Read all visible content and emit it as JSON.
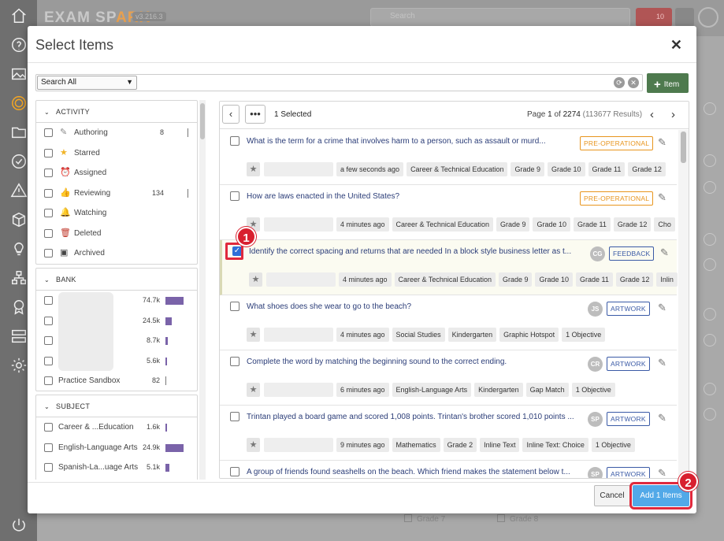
{
  "app": {
    "logo_part1": "EXAM SP",
    "logo_part2": "ARK",
    "version": "v3.216.3",
    "search_placeholder": "Search",
    "notification_count": "10"
  },
  "modal": {
    "title": "Select Items",
    "close_label": "✕",
    "search_select_value": "Search All",
    "add_item_label": "Item",
    "cancel_label": "Cancel",
    "confirm_label": "Add 1 Items"
  },
  "activity": {
    "header": "ACTIVITY",
    "items": [
      {
        "label": "Authoring",
        "count": "8",
        "icon": "pencil-icon"
      },
      {
        "label": "Starred",
        "count": "",
        "icon": "star-icon"
      },
      {
        "label": "Assigned",
        "count": "",
        "icon": "alarm-clock-icon"
      },
      {
        "label": "Reviewing",
        "count": "134",
        "icon": "thumbs-up-icon"
      },
      {
        "label": "Watching",
        "count": "",
        "icon": "bell-icon"
      },
      {
        "label": "Deleted",
        "count": "",
        "icon": "trash-icon"
      },
      {
        "label": "Archived",
        "count": "",
        "icon": "archive-icon"
      }
    ]
  },
  "bank": {
    "header": "BANK",
    "items": [
      {
        "label": "",
        "count": "74.7k",
        "fill": 1.0
      },
      {
        "label": "",
        "count": "24.5k",
        "fill": 0.33
      },
      {
        "label": "",
        "count": "8.7k",
        "fill": 0.12
      },
      {
        "label": "",
        "count": "5.6k",
        "fill": 0.08
      },
      {
        "label": "Practice Sandbox",
        "count": "82",
        "fill": 0.0
      }
    ]
  },
  "subject": {
    "header": "SUBJECT",
    "items": [
      {
        "label": "Career & ...Education",
        "count": "1.6k",
        "fill": 0.07
      },
      {
        "label": "English-Language Arts",
        "count": "24.9k",
        "fill": 1.0
      },
      {
        "label": "Spanish-La...uage Arts",
        "count": "5.1k",
        "fill": 0.2
      }
    ]
  },
  "results": {
    "selected_text": "1 Selected",
    "page_prefix": "Page ",
    "page_current": "1",
    "page_of": " of ",
    "page_total": "2274",
    "results_count": " (113677 Results)",
    "items": [
      {
        "question": "What is the term for a crime that involves harm to a person, such as assault or murd...",
        "status": "PRE-OPERATIONAL",
        "avatar": "",
        "checked": false,
        "time": "a few seconds ago",
        "tags": [
          "Career & Technical Education",
          "Grade 9",
          "Grade 10",
          "Grade 11",
          "Grade 12"
        ]
      },
      {
        "question": "How are laws enacted in the United States?",
        "status": "PRE-OPERATIONAL",
        "avatar": "",
        "checked": false,
        "time": "4 minutes ago",
        "tags": [
          "Career & Technical Education",
          "Grade 9",
          "Grade 10",
          "Grade 11",
          "Grade 12",
          "Cho"
        ]
      },
      {
        "question": "Identify the correct spacing and returns that are needed In a block style business letter as t...",
        "status": "FEEDBACK",
        "avatar": "CG",
        "checked": true,
        "time": "4 minutes ago",
        "tags": [
          "Career & Technical Education",
          "Grade 9",
          "Grade 10",
          "Grade 11",
          "Grade 12",
          "Inlin"
        ]
      },
      {
        "question": "What shoes does she wear to go to the beach?",
        "status": "ARTWORK",
        "avatar": "JS",
        "checked": false,
        "time": "4 minutes ago",
        "tags": [
          "Social Studies",
          "Kindergarten",
          "Graphic Hotspot",
          "1 Objective"
        ]
      },
      {
        "question": "Complete the word by matching the beginning sound to the correct ending.",
        "status": "ARTWORK",
        "avatar": "CR",
        "checked": false,
        "time": "6 minutes ago",
        "tags": [
          "English-Language Arts",
          "Kindergarten",
          "Gap Match",
          "1 Objective"
        ]
      },
      {
        "question": "Trintan played a board game and scored 1,008 points. Trintan's brother scored 1,010 points ...",
        "status": "ARTWORK",
        "avatar": "SP",
        "checked": false,
        "time": "9 minutes ago",
        "tags": [
          "Mathematics",
          "Grade 2",
          "Inline Text",
          "Inline Text: Choice",
          "1 Objective"
        ]
      },
      {
        "question": "A group of friends found seashells on the beach. Which friend makes the statement below t...",
        "status": "ARTWORK",
        "avatar": "SP",
        "checked": false,
        "time": "",
        "tags": []
      }
    ]
  },
  "background": {
    "grades": [
      "Grade 7",
      "Grade 8"
    ]
  },
  "annotations": {
    "step1": "1",
    "step2": "2"
  },
  "colors": {
    "accent_purple": "#7a63a9",
    "status_orange": "#e8951e",
    "status_blue": "#3a5aa6",
    "confirm_blue": "#52a9e8",
    "highlight_red": "#e0293d",
    "add_green": "#4e7a4e"
  }
}
